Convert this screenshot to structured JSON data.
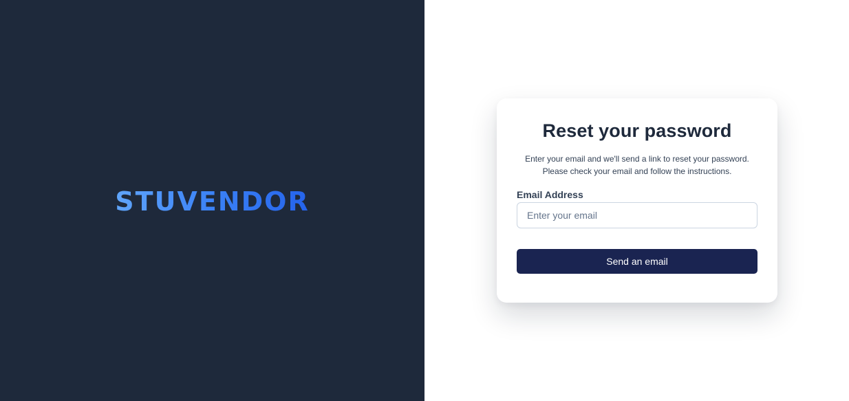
{
  "brand": {
    "name": "STUVENDOR"
  },
  "reset_form": {
    "title": "Reset your password",
    "description_line1": "Enter your email and we'll send a link to reset your password.",
    "description_line2": "Please check your email and follow the instructions.",
    "email_label": "Email Address",
    "email_value": "",
    "email_placeholder": "Enter your email",
    "submit_label": "Send an email"
  },
  "colors": {
    "brand_panel_bg": "#1e293b",
    "logo_gradient_start": "#60a5fa",
    "logo_gradient_end": "#2563eb",
    "button_bg": "#1a2451",
    "title_text": "#1e293b"
  }
}
